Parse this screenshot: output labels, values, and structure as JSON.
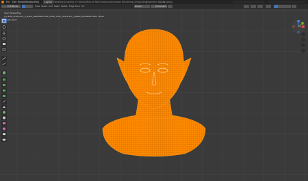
{
  "menu": {
    "items": [
      "File",
      "Edit",
      "Render",
      "Window",
      "Help"
    ]
  },
  "workspaces": {
    "tabs": [
      "Layout",
      "Modeling",
      "Sculpting",
      "UV Editing",
      "Texture Paint",
      "Shading",
      "Animation",
      "Rendering",
      "Compositing",
      "Geometry Nodes",
      "Scripting"
    ],
    "active": "Layout"
  },
  "header": {
    "mode": "Edit Mode",
    "menus": [
      "View",
      "Select",
      "Add",
      "Mesh",
      "Vertex",
      "Edge",
      "Face",
      "UV"
    ],
    "transform": "Global",
    "snap": "Increment"
  },
  "viewport": {
    "perspective_label": "User Perspective",
    "object_path": "(1) BOD_Character_U_Base_HeadMesh.000 | BOD_Char_Character_U_Base_HeadMesh.000 : Base",
    "info_label": "Construction",
    "mesh_color": "#ff8a00",
    "mesh_line_color": "#b35a00"
  },
  "gizmo": {
    "x_color": "#e2464e",
    "y_color": "#6ea52b",
    "z_color": "#3f7fd6"
  },
  "toolbar": {
    "tools": [
      "select-box",
      "cursor",
      "move",
      "rotate",
      "scale",
      "transform",
      "annotate",
      "measure",
      "add-cube",
      "extrude",
      "inset",
      "bevel",
      "loop-cut",
      "knife",
      "poly-build",
      "spin",
      "smooth",
      "edge-slide",
      "shrink-fatten",
      "shear",
      "rip"
    ]
  }
}
